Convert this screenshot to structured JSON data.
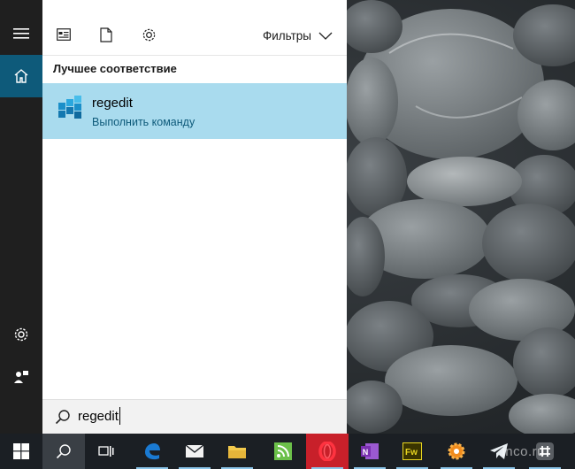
{
  "panel": {
    "filters_label": "Фильтры",
    "section_title": "Лучшее соответствие",
    "best_match": {
      "title": "regedit",
      "subtitle": "Выполнить команду"
    }
  },
  "search": {
    "value": "regedit"
  },
  "rail": {
    "items": [
      "hamburger-menu-icon",
      "home-icon",
      "settings-icon",
      "feedback-icon"
    ]
  },
  "toolbar": {
    "icons": [
      "apps-icon",
      "documents-icon",
      "settings-icon",
      "chevron-down-icon"
    ]
  },
  "taskbar": {
    "items": [
      "start-windows-icon",
      "search-icon",
      "task-view-icon",
      "edge-icon",
      "mail-icon",
      "file-explorer-icon",
      "feedly-icon",
      "opera-icon",
      "onenote-icon",
      "fireworks-icon",
      "settings-gear-icon",
      "telegram-icon",
      "slack-icon"
    ],
    "watermark": "inco.ru"
  },
  "colors": {
    "accent": "#0e5a7a",
    "selection": "#a9dbee",
    "taskbar": "#1b1f24",
    "rail": "#1f1f1f"
  }
}
